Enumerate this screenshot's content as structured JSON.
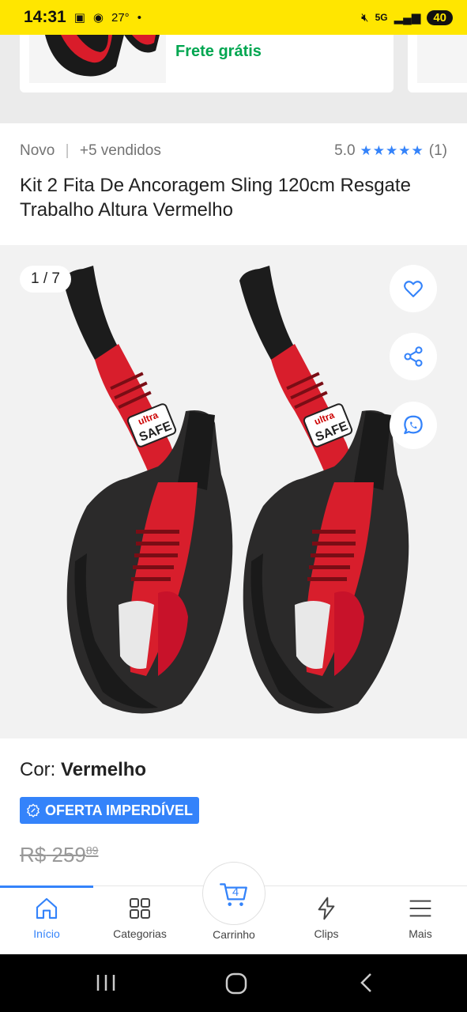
{
  "status_bar": {
    "time": "14:31",
    "temperature": "27°",
    "network": "5G",
    "battery": "40"
  },
  "recommendation": {
    "shipping_label": "Frete grátis"
  },
  "product": {
    "condition": "Novo",
    "separator": "|",
    "sold": "+5 vendidos",
    "rating_value": "5.0",
    "rating_stars": 5,
    "rating_count": "(1)",
    "title": "Kit 2 Fita De Ancoragem Sling 120cm Resgate Trabalho Altura Vermelho"
  },
  "gallery": {
    "counter": "1 / 7",
    "actions": [
      "heart-icon",
      "share-icon",
      "whatsapp-icon"
    ],
    "brand_mark": "ultra SAFE"
  },
  "details": {
    "color_label": "Cor:",
    "color_value": "Vermelho",
    "deal_badge": "OFERTA IMPERDÍVEL",
    "old_price_currency": "R$",
    "old_price_whole": "259",
    "old_price_cents": "89"
  },
  "bottom_nav": {
    "items": [
      {
        "label": "Início",
        "icon": "home-icon",
        "active": true
      },
      {
        "label": "Categorias",
        "icon": "grid-icon",
        "active": false
      },
      {
        "label": "Carrinho",
        "icon": "cart-icon",
        "active": false,
        "badge": "4"
      },
      {
        "label": "Clips",
        "icon": "lightning-icon",
        "active": false
      },
      {
        "label": "Mais",
        "icon": "menu-icon",
        "active": false
      }
    ]
  },
  "colors": {
    "accent": "#3483fa",
    "brand_yellow": "#ffe600",
    "free_shipping": "#00a650"
  }
}
